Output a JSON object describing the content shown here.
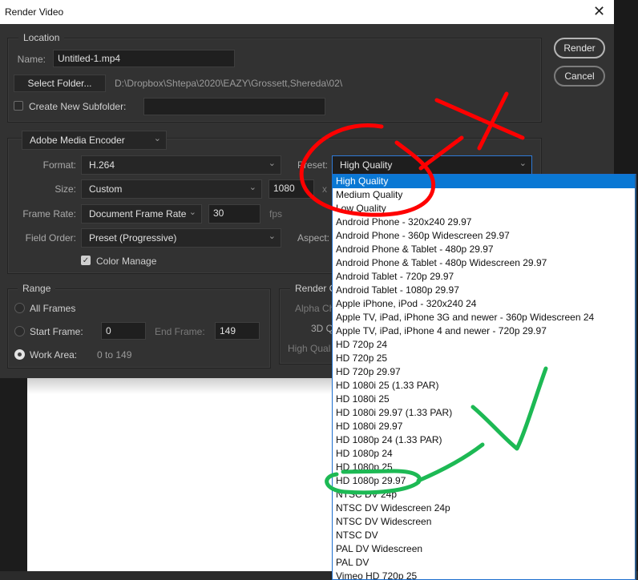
{
  "window": {
    "title": "Render Video",
    "close_icon": "close-icon"
  },
  "actions": {
    "render": "Render",
    "cancel": "Cancel"
  },
  "location": {
    "legend": "Location",
    "name_label": "Name:",
    "name_value": "Untitled-1.mp4",
    "select_folder": "Select Folder...",
    "folder_path": "D:\\Dropbox\\Shtepa\\2020\\EAZY\\Grossett,Shereda\\02\\",
    "subfolder_label": "Create New Subfolder:",
    "subfolder_checked": false,
    "subfolder_value": ""
  },
  "encoder": {
    "renderer": "Adobe Media Encoder",
    "format_label": "Format:",
    "format_value": "H.264",
    "preset_label": "Preset:",
    "preset_value": "High Quality",
    "size_label": "Size:",
    "size_value": "Custom",
    "width_value": "1080",
    "size_x": "x",
    "frame_rate_label": "Frame Rate:",
    "frame_rate_value": "Document Frame Rate",
    "fps_value": "30",
    "fps_unit": "fps",
    "field_order_label": "Field Order:",
    "field_order_value": "Preset (Progressive)",
    "aspect_label": "Aspect:",
    "color_manage_label": "Color Manage",
    "color_manage_checked": true
  },
  "range": {
    "legend": "Range",
    "all_frames": "All Frames",
    "start_frame_label": "Start Frame:",
    "start_frame_value": "0",
    "end_frame_label": "End Frame:",
    "end_frame_value": "149",
    "work_area_label": "Work Area:",
    "work_area_value": "0 to 149",
    "selected": "Work Area"
  },
  "render_options": {
    "legend": "Render O",
    "alpha": "Alpha Ch",
    "quality_3d": "3D Q",
    "high_quality": "High Qual"
  },
  "preset_dropdown": {
    "selected_index": 0,
    "items": [
      "High Quality",
      "Medium Quality",
      "Low Quality",
      "Android Phone - 320x240 29.97",
      "Android Phone - 360p Widescreen 29.97",
      "Android Phone & Tablet - 480p 29.97",
      "Android Phone & Tablet - 480p Widescreen 29.97",
      "Android Tablet - 720p 29.97",
      "Android Tablet - 1080p 29.97",
      "Apple iPhone, iPod - 320x240 24",
      "Apple TV, iPad, iPhone 3G and newer - 360p Widescreen 24",
      "Apple TV, iPad, iPhone 4 and newer - 720p 29.97",
      "HD 720p 24",
      "HD 720p 25",
      "HD 720p 29.97",
      "HD 1080i 25 (1.33 PAR)",
      "HD 1080i 25",
      "HD 1080i 29.97 (1.33 PAR)",
      "HD 1080i 29.97",
      "HD 1080p 24 (1.33 PAR)",
      "HD 1080p 24",
      "HD 1080p 25",
      "HD 1080p 29.97",
      "NTSC DV 24p",
      "NTSC DV Widescreen 24p",
      "NTSC DV Widescreen",
      "NTSC DV",
      "PAL DV Widescreen",
      "PAL DV",
      "Vimeo HD 720p 25"
    ]
  },
  "annotations": {
    "red_color": "#ff0000",
    "green_color": "#1db954",
    "red_marks": "circle around High/Medium/Low Quality with X (wrong)",
    "green_marks": "circle around HD 1080p 29.97 with check mark (correct)"
  }
}
